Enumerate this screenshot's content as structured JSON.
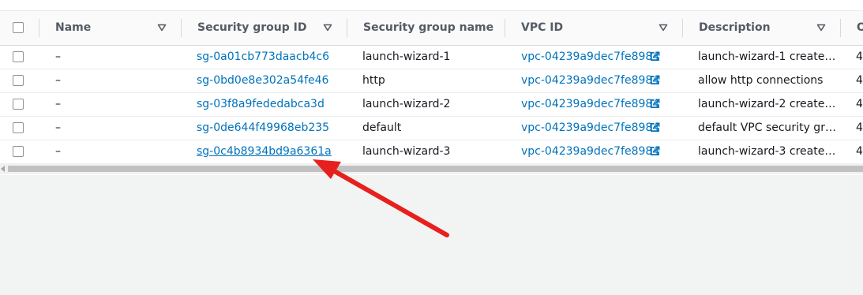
{
  "table": {
    "columns": [
      {
        "key": "name",
        "label": "Name"
      },
      {
        "key": "sg_id",
        "label": "Security group ID"
      },
      {
        "key": "sg_name",
        "label": "Security group name"
      },
      {
        "key": "vpc_id",
        "label": "VPC ID"
      },
      {
        "key": "description",
        "label": "Description"
      },
      {
        "key": "owner",
        "label": "O"
      }
    ],
    "rows": [
      {
        "name": "–",
        "sg_id": "sg-0a01cb773daacb4c6",
        "sg_name": "launch-wizard-1",
        "vpc_id": "vpc-04239a9dec7fe8984",
        "description": "launch-wizard-1 create…",
        "owner": "4"
      },
      {
        "name": "–",
        "sg_id": "sg-0bd0e8e302a54fe46",
        "sg_name": "http",
        "vpc_id": "vpc-04239a9dec7fe8984",
        "description": "allow http connections",
        "owner": "4"
      },
      {
        "name": "–",
        "sg_id": "sg-03f8a9fededabca3d",
        "sg_name": "launch-wizard-2",
        "vpc_id": "vpc-04239a9dec7fe8984",
        "description": "launch-wizard-2 create…",
        "owner": "4"
      },
      {
        "name": "–",
        "sg_id": "sg-0de644f49968eb235",
        "sg_name": "default",
        "vpc_id": "vpc-04239a9dec7fe8984",
        "description": "default VPC security gr…",
        "owner": "4"
      },
      {
        "name": "–",
        "sg_id": "sg-0c4b8934bd9a6361a",
        "sg_name": "launch-wizard-3",
        "vpc_id": "vpc-04239a9dec7fe8984",
        "description": "launch-wizard-3 create…",
        "owner": "4"
      }
    ]
  },
  "colors": {
    "link": "#0073bb",
    "annotation_arrow": "#e8201d"
  },
  "icons": {
    "sort": "caret-down-outline-icon",
    "external": "external-link-icon",
    "scroll_left": "scroll-left-arrow-icon"
  }
}
